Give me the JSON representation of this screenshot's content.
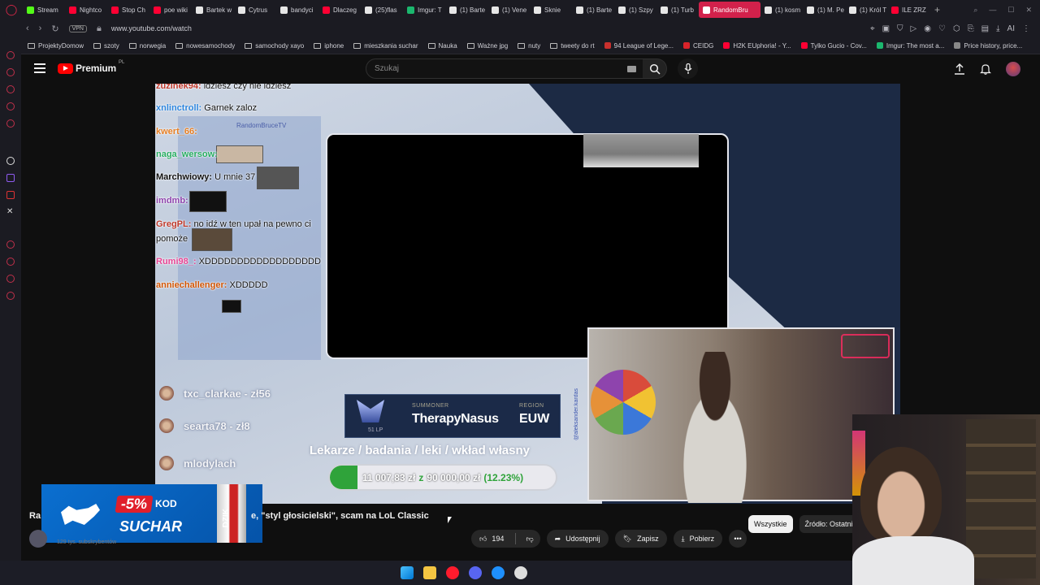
{
  "browser": {
    "tabs": [
      {
        "label": "Stream",
        "color": "#53fc18"
      },
      {
        "label": "Nightco",
        "color": "#ff0033"
      },
      {
        "label": "Stop Ch",
        "color": "#ff0033"
      },
      {
        "label": "poe wiki",
        "color": "#ff0033"
      },
      {
        "label": "Bartek w",
        "color": "#e6e6e6"
      },
      {
        "label": "Cytrus",
        "color": "#e6e6e6"
      },
      {
        "label": "bandyci",
        "color": "#e6e6e6"
      },
      {
        "label": "Dlaczeg",
        "color": "#ff0033"
      },
      {
        "label": "(25)flas",
        "color": "#e6e6e6"
      },
      {
        "label": "Imgur: T",
        "color": "#1bb76e"
      },
      {
        "label": "(1) Barte",
        "color": "#e6e6e6"
      },
      {
        "label": "(1) Vene",
        "color": "#e6e6e6"
      },
      {
        "label": "Sknie",
        "color": "#e6e6e6"
      },
      {
        "label": "(1) Barte",
        "color": "#e6e6e6"
      },
      {
        "label": "(1) Szpy",
        "color": "#e6e6e6"
      },
      {
        "label": "(1) Turb",
        "color": "#e6e6e6"
      }
    ],
    "active_tab": "RandomBru",
    "tabs_after": [
      {
        "label": "(1) kosm",
        "color": "#e6e6e6"
      },
      {
        "label": "(1) M. Pe",
        "color": "#e6e6e6"
      },
      {
        "label": "(1) Król T",
        "color": "#e6e6e6"
      },
      {
        "label": "ILE ZRZ",
        "color": "#ff0033"
      }
    ],
    "vpn_label": "VPN",
    "url": "www.youtube.com/watch",
    "ai_label": "AI",
    "bookmarks": [
      {
        "label": "ProjektyDomow",
        "type": "folder"
      },
      {
        "label": "szoty",
        "type": "folder"
      },
      {
        "label": "norwegia",
        "type": "folder"
      },
      {
        "label": "nowesamochody",
        "type": "folder"
      },
      {
        "label": "samochody xayo",
        "type": "folder"
      },
      {
        "label": "iphone",
        "type": "folder"
      },
      {
        "label": "mieszkania suchar",
        "type": "folder"
      },
      {
        "label": "Nauka",
        "type": "folder"
      },
      {
        "label": "Ważne jpg",
        "type": "folder"
      },
      {
        "label": "nuty",
        "type": "folder"
      },
      {
        "label": "tweety do rt",
        "type": "folder"
      },
      {
        "label": "94 League of Lege...",
        "type": "site",
        "color": "#c8302d"
      },
      {
        "label": "CEIDG",
        "type": "site",
        "color": "#d8232a"
      },
      {
        "label": "H2K EUphoria! - Y...",
        "type": "site",
        "color": "#ff0033"
      },
      {
        "label": "Tylko Gucio - Cov...",
        "type": "site",
        "color": "#ff0033"
      },
      {
        "label": "Imgur: The most a...",
        "type": "site",
        "color": "#1bb76e"
      },
      {
        "label": "Price history, price...",
        "type": "site",
        "color": "#888888"
      }
    ]
  },
  "youtube": {
    "logo_text": "Premium",
    "region": "PL",
    "search_placeholder": "Szukaj"
  },
  "stream": {
    "chat": [
      {
        "user": "zuzinek94:",
        "msg": " idziesz czy nie idziesz",
        "color": "#c1392b"
      },
      {
        "user": "xnlinctroll:",
        "msg": " Garnek zaloz",
        "color": "#2e86de"
      },
      {
        "user": "kwert_66:",
        "msg": "",
        "color": "#e67e22"
      },
      {
        "user": "naga_wersow:",
        "msg": "",
        "color": "#27ae60"
      },
      {
        "user": "Marchwiowy:",
        "msg": " U mnie 37",
        "color": "#111111"
      },
      {
        "user": "imdmb:",
        "msg": "",
        "color": "#8e44ad"
      },
      {
        "user": "GregPL:",
        "msg": " no idź w ten upał na pewno ci",
        "color": "#c0392b"
      },
      {
        "user": "",
        "msg": "pomoże",
        "color": "#111111"
      },
      {
        "user": "Rumi98_:",
        "msg": " XDDDDDDDDDDDDDDDDDD",
        "color": "#e84393"
      },
      {
        "user": "anniechallenger:",
        "msg": " XDDDDD",
        "color": "#d35400"
      }
    ],
    "watermark": "RandomBruceTV",
    "donors": [
      {
        "name": "txc_clarkae - zł56"
      },
      {
        "name": "searta78 - zł8"
      },
      {
        "name": "mlodylach"
      }
    ],
    "summoner": {
      "label": "SUMMONER",
      "name": "TherapyNasus",
      "region_label": "REGION",
      "region": "EUW",
      "lp": "51 LP"
    },
    "goal": {
      "title": "Lekarze / badania / leki / wkład własny",
      "current": "11 007,83 zł",
      "separator": "z",
      "target": "90 000,00 zł",
      "percent_label": "(12.23%)",
      "progress": 12.23
    },
    "vertical_tag": "@aleksander.kardas"
  },
  "promo": {
    "discount": "-5%",
    "kod": "KOD",
    "code": "SUCHAR",
    "can_label": "DZIK"
  },
  "video": {
    "title_prefix": "Ra",
    "title_rest": "e, \"styl głosicielski\", scam na LoL Classic",
    "channel_sub": "129 tys. subskrybentów",
    "likes": "194",
    "share": "Udostępnij",
    "save": "Zapisz",
    "download": "Pobierz"
  },
  "chips": [
    {
      "label": "Wszystkie",
      "active": true
    },
    {
      "label": "Źródło: Ostatni",
      "active": false
    }
  ]
}
